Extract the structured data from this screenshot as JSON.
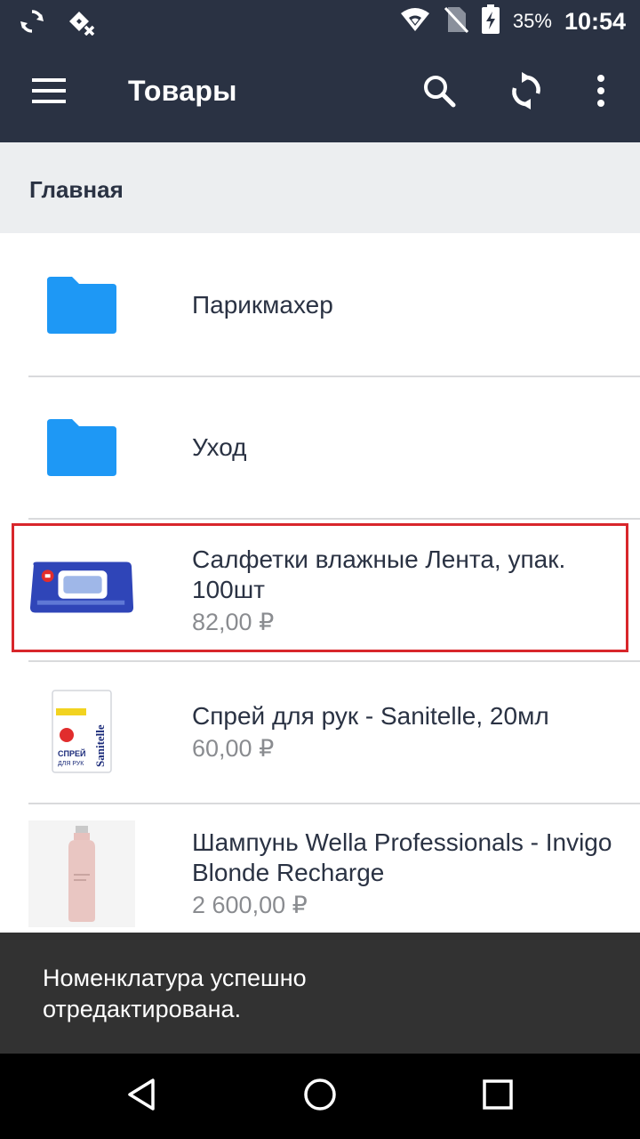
{
  "status_bar": {
    "battery_percent": "35%",
    "time": "10:54",
    "icons": [
      "sync-icon",
      "signal-app-icon",
      "wifi-icon",
      "no-sim-icon",
      "battery-charging-icon"
    ]
  },
  "app_bar": {
    "title": "Товары",
    "icons": [
      "menu-icon",
      "search-icon",
      "sync-icon",
      "more-vert-icon"
    ]
  },
  "breadcrumb": {
    "label": "Главная"
  },
  "list": {
    "folders": [
      {
        "label": "Парикмахер",
        "icon": "folder-icon"
      },
      {
        "label": "Уход",
        "icon": "folder-icon"
      }
    ],
    "products": [
      {
        "title": "Салфетки влажные Лента, упак. 100шт",
        "price": "82,00 ₽",
        "image": "wet-wipes-image",
        "selected": true
      },
      {
        "title": "Спрей для рук - Sanitelle, 20мл",
        "price": "60,00 ₽",
        "image": "hand-spray-image"
      },
      {
        "title": "Шампунь Wella Professionals - Invigo Blonde Recharge",
        "price": "2 600,00 ₽",
        "image": "shampoo-bottle-image"
      }
    ],
    "spray_label": {
      "brand": "Sanitelle",
      "line1": "СПРЕЙ",
      "line2": "ДЛЯ РУК"
    }
  },
  "snackbar": {
    "message": "Номенклатура успешно отредактирована."
  },
  "nav_bar": {
    "icons": [
      "back-icon",
      "home-icon",
      "recents-icon"
    ]
  },
  "colors": {
    "app_bar": "#2a3243",
    "folder": "#1e98f5",
    "highlight": "#d8262b",
    "snackbar": "#323232"
  }
}
